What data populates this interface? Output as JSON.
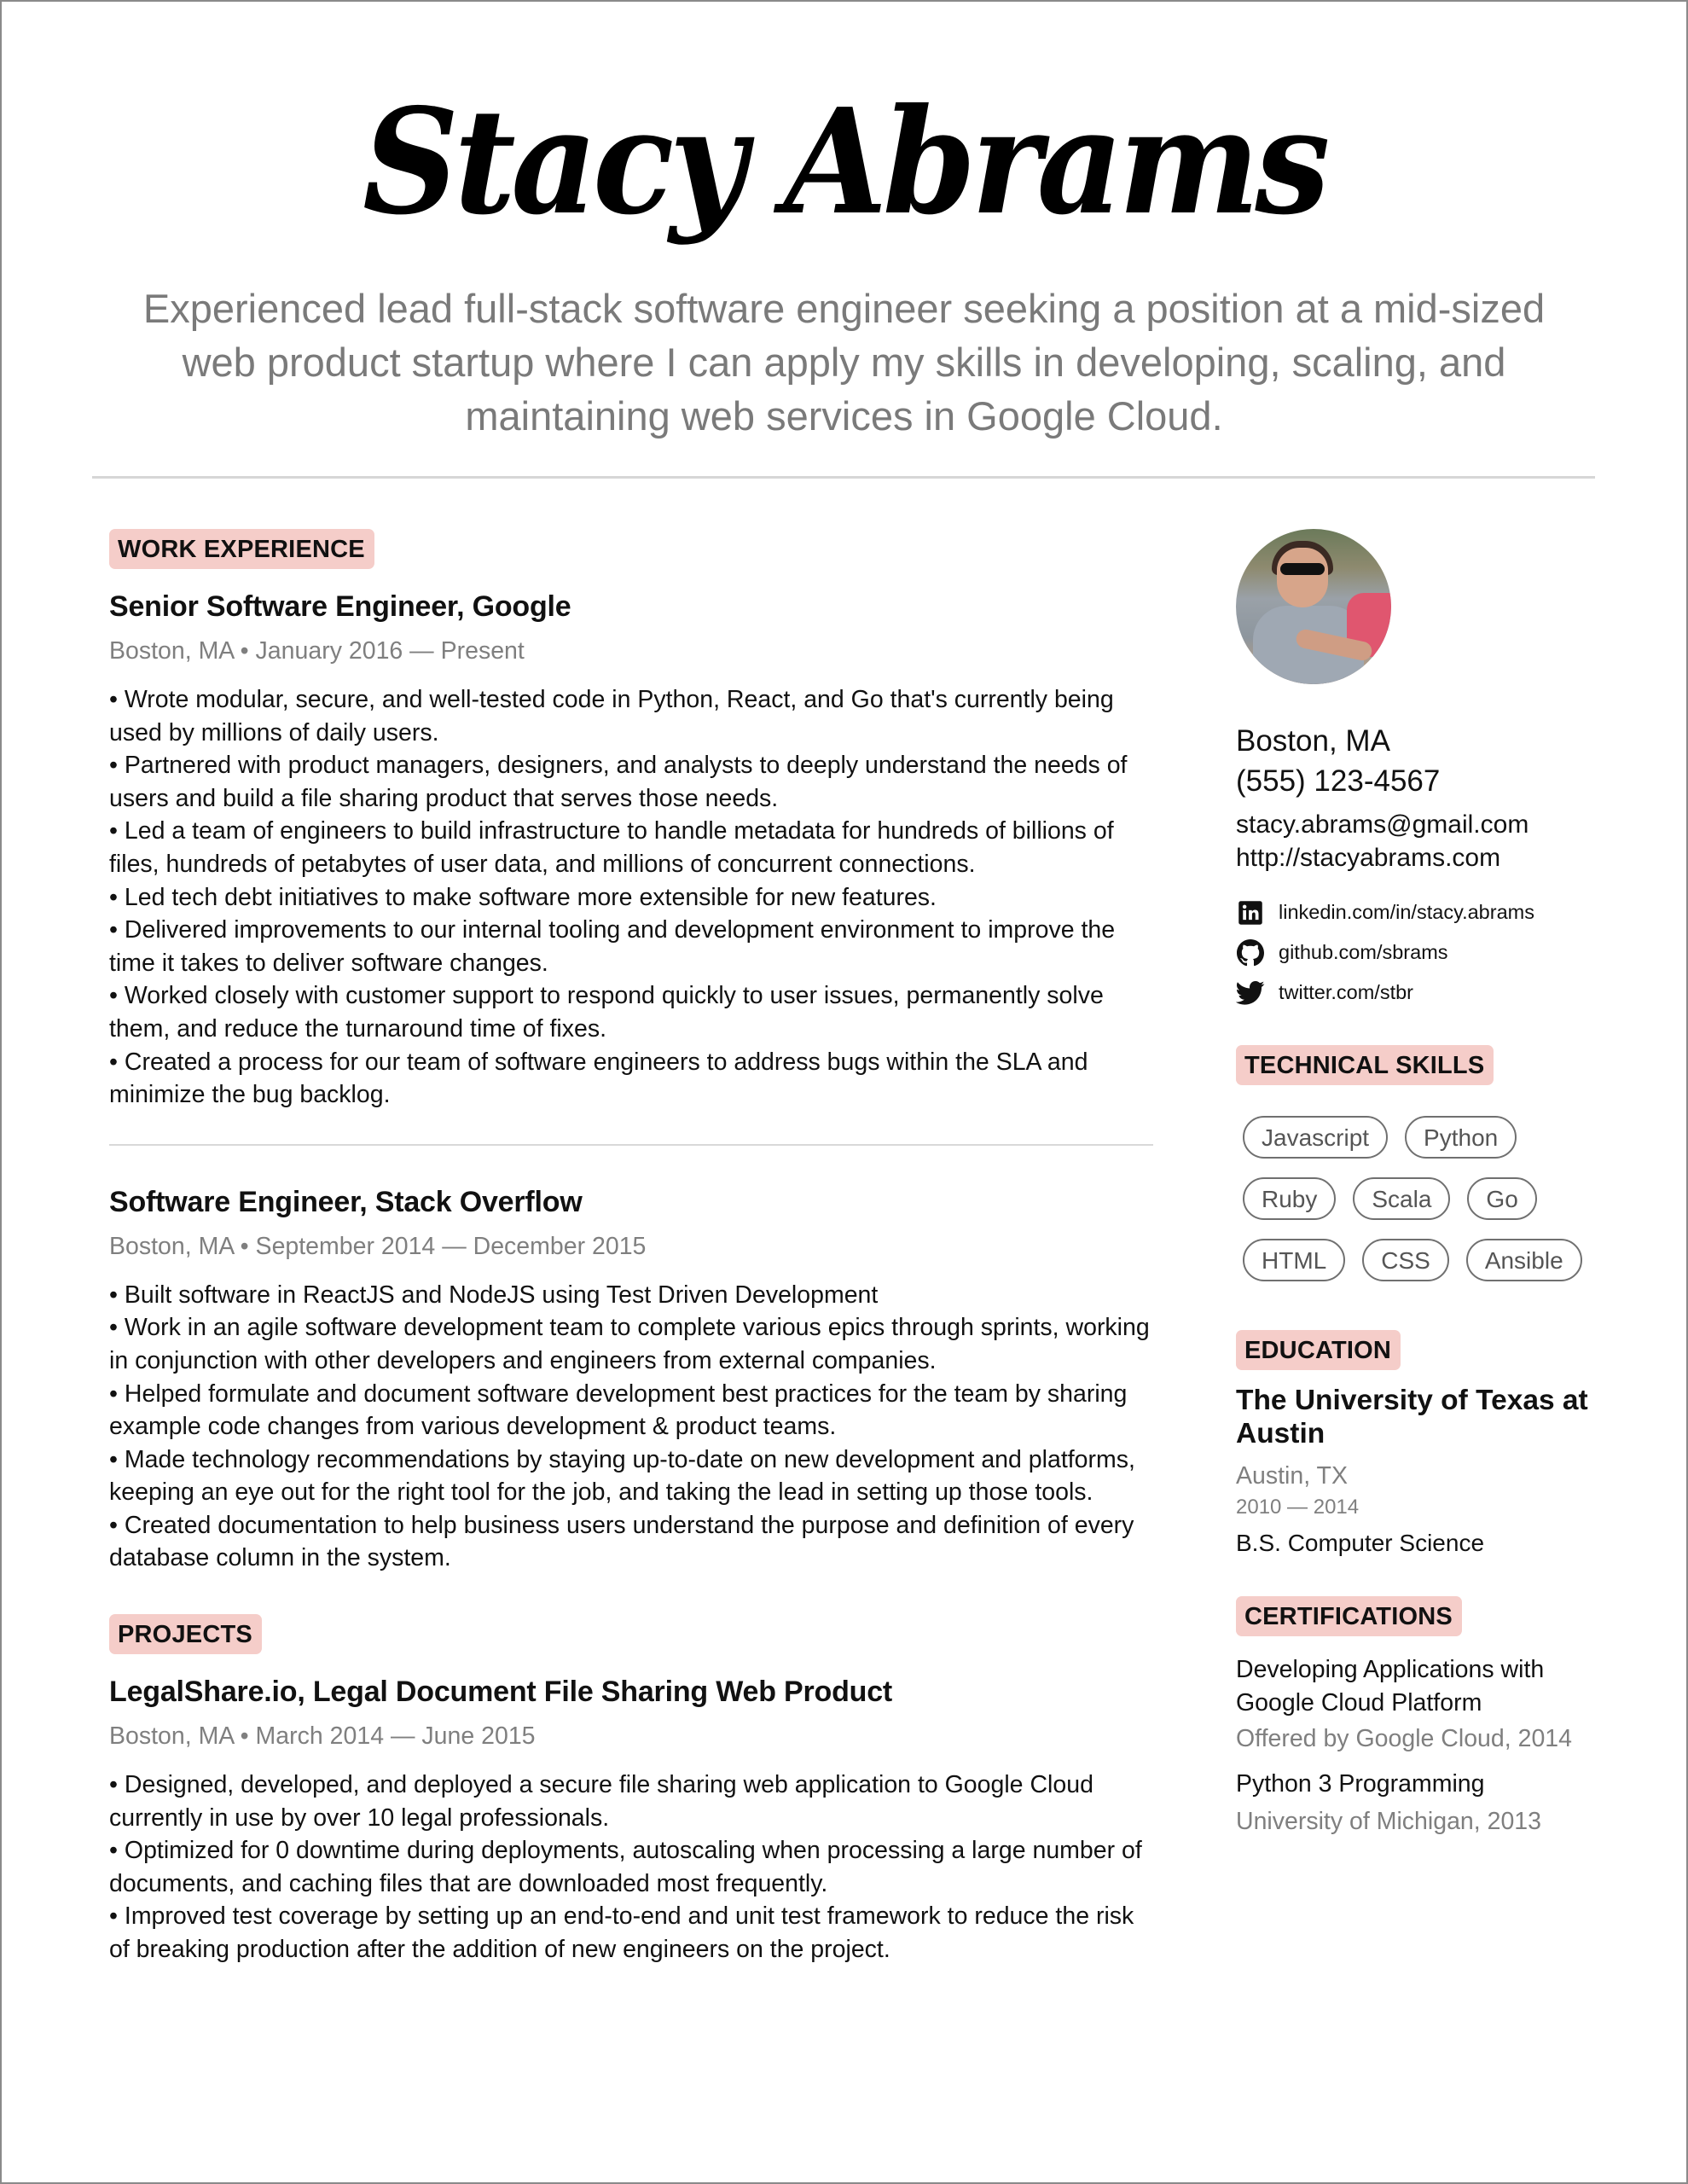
{
  "header": {
    "name": "Stacy Abrams",
    "summary": "Experienced lead full-stack software engineer seeking a position at a mid-sized web product startup where I can apply my skills in developing, scaling, and maintaining web services in Google Cloud."
  },
  "colors": {
    "badge_bg": "#f5cdc9",
    "muted_text": "#7f7f7f",
    "summary_text": "#7a7a7a",
    "rule": "#d6d6d6"
  },
  "work": {
    "heading": "WORK EXPERIENCE",
    "jobs": [
      {
        "title": "Senior Software Engineer, Google",
        "meta": "Boston, MA • January 2016 — Present",
        "bullets": [
          "• Wrote modular, secure, and well-tested code in Python, React, and Go that's currently being used by millions of daily users.",
          "• Partnered with product managers, designers, and analysts to deeply understand the needs of users and build a file sharing product that serves those needs.",
          "• Led a team of engineers to build infrastructure to handle metadata for hundreds of billions of files, hundreds of petabytes of user data, and millions of concurrent connections.",
          "• Led tech debt initiatives to make software more extensible for new features.",
          "• Delivered improvements to our internal tooling and development environment to improve the time it takes to deliver software changes.",
          "• Worked closely with customer support to respond quickly to user issues, permanently solve them, and reduce the turnaround time of fixes.",
          "• Created a process for our team of software engineers to address bugs within the SLA and minimize the bug backlog."
        ]
      },
      {
        "title": "Software Engineer, Stack Overflow",
        "meta": "Boston, MA • September 2014 — December 2015",
        "bullets": [
          "• Built software in ReactJS and NodeJS using Test Driven Development",
          "• Work in an agile software development team to complete various epics through sprints, working in conjunction with other developers and engineers from external companies.",
          "• Helped formulate and document software development best practices for the team by sharing example code changes from various development & product teams.",
          "• Made technology recommendations by staying up-to-date on new development and platforms, keeping an eye out for the right tool for the job, and taking the lead in setting up those tools.",
          "• Created documentation to help business users understand the purpose and definition of every database column in the system."
        ]
      }
    ]
  },
  "projects": {
    "heading": "PROJECTS",
    "items": [
      {
        "title": "LegalShare.io, Legal Document File Sharing Web Product",
        "meta": "Boston, MA • March 2014 — June 2015",
        "bullets": [
          "• Designed, developed, and deployed a secure file sharing web application to Google Cloud currently in use by over 10 legal professionals.",
          "• Optimized for 0 downtime during deployments, autoscaling when processing a large number of documents, and caching files that are downloaded most frequently.",
          "• Improved test coverage by setting up an end-to-end and unit test framework to reduce the risk of breaking production after the addition of new engineers on the project."
        ]
      }
    ]
  },
  "contact": {
    "photo": "profile-photo",
    "city": "Boston, MA",
    "phone": "(555) 123-4567",
    "email": "stacy.abrams@gmail.com",
    "website": "http://stacyabrams.com",
    "social": [
      {
        "icon": "linkedin-icon",
        "label": "linkedin.com/in/stacy.abrams"
      },
      {
        "icon": "github-icon",
        "label": "github.com/sbrams"
      },
      {
        "icon": "twitter-icon",
        "label": "twitter.com/stbr"
      }
    ]
  },
  "skills": {
    "heading": "TECHNICAL SKILLS",
    "items": [
      "Javascript",
      "Python",
      "Ruby",
      "Scala",
      "Go",
      "HTML",
      "CSS",
      "Ansible"
    ]
  },
  "education": {
    "heading": "EDUCATION",
    "school": "The University of Texas at Austin",
    "location": "Austin, TX",
    "years": "2010 — 2014",
    "degree": "B.S. Computer Science"
  },
  "certifications": {
    "heading": "CERTIFICATIONS",
    "items": [
      {
        "title": "Developing Applications with Google Cloud Platform",
        "issuer": "Offered by Google Cloud, 2014"
      },
      {
        "title": "Python 3 Programming",
        "issuer": "University of Michigan, 2013"
      }
    ]
  }
}
